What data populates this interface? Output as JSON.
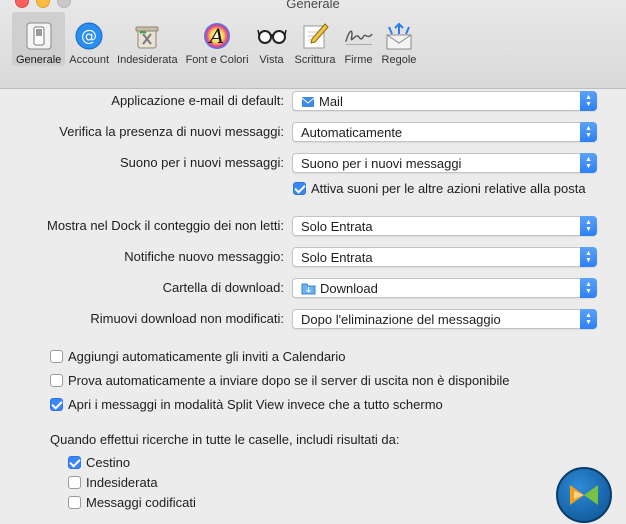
{
  "window": {
    "title": "Generale"
  },
  "toolbar": {
    "items": [
      {
        "label": "Generale",
        "icon": "general-switch-icon",
        "selected": true
      },
      {
        "label": "Account",
        "icon": "at-sign-icon"
      },
      {
        "label": "Indesiderata",
        "icon": "junk-trash-icon"
      },
      {
        "label": "Font e Colori",
        "icon": "font-colors-icon"
      },
      {
        "label": "Vista",
        "icon": "glasses-icon"
      },
      {
        "label": "Scrittura",
        "icon": "pencil-paper-icon"
      },
      {
        "label": "Firme",
        "icon": "signature-icon"
      },
      {
        "label": "Regole",
        "icon": "rules-envelope-icon"
      }
    ]
  },
  "settings": {
    "default_mail_app": {
      "label": "Applicazione e-mail di default:",
      "value": "Mail"
    },
    "check_new": {
      "label": "Verifica la presenza di nuovi messaggi:",
      "value": "Automaticamente"
    },
    "new_sound": {
      "label": "Suono per i nuovi messaggi:",
      "value": "Suono per i nuovi messaggi"
    },
    "other_sounds": {
      "label": "Attiva suoni per le altre azioni relative alla posta",
      "checked": true
    },
    "dock_count": {
      "label": "Mostra nel Dock il conteggio dei non letti:",
      "value": "Solo Entrata"
    },
    "notifications": {
      "label": "Notifiche nuovo messaggio:",
      "value": "Solo Entrata"
    },
    "download_folder": {
      "label": "Cartella di download:",
      "value": "Download"
    },
    "remove_downloads": {
      "label": "Rimuovi download non modificati:",
      "value": "Dopo l'eliminazione del messaggio"
    }
  },
  "options": {
    "add_invites": {
      "label": "Aggiungi automaticamente gli inviti a Calendario",
      "checked": false
    },
    "try_send_later": {
      "label": "Prova automaticamente a inviare dopo se il server di uscita non è disponibile",
      "checked": false
    },
    "split_view": {
      "label": "Apri i messaggi in modalità Split View invece che a tutto schermo",
      "checked": true
    }
  },
  "search": {
    "heading": "Quando effettui ricerche in tutte le caselle, includi risultati da:",
    "trash": {
      "label": "Cestino",
      "checked": true
    },
    "junk": {
      "label": "Indesiderata",
      "checked": false
    },
    "encrypted": {
      "label": "Messaggi codificati",
      "checked": false
    }
  },
  "colors": {
    "accent": "#3b86f7",
    "background": "#ececec"
  }
}
